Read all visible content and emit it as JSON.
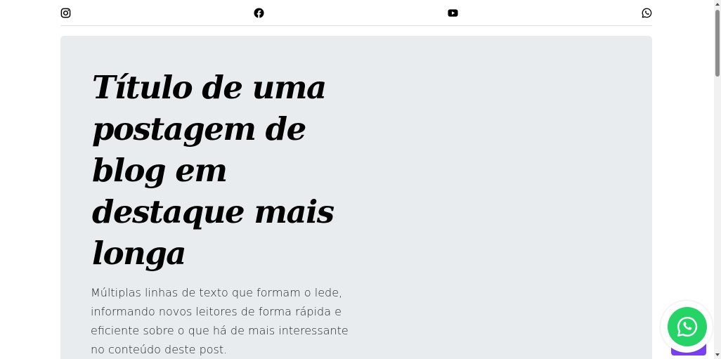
{
  "social": {
    "icons": [
      "instagram-icon",
      "facebook-icon",
      "youtube-icon",
      "whatsapp-icon"
    ]
  },
  "hero": {
    "title": "Título de uma postagem de blog em destaque mais longa",
    "lede": "Múltiplas linhas de texto que formam o lede, informando novos leitores de forma rápida e eficiente sobre o que há de mais interessante no conteúdo deste post."
  },
  "colors": {
    "hero_background": "#e9ecef",
    "whatsapp_green": "#25d366",
    "purple_accent": "#7b3ff2"
  }
}
